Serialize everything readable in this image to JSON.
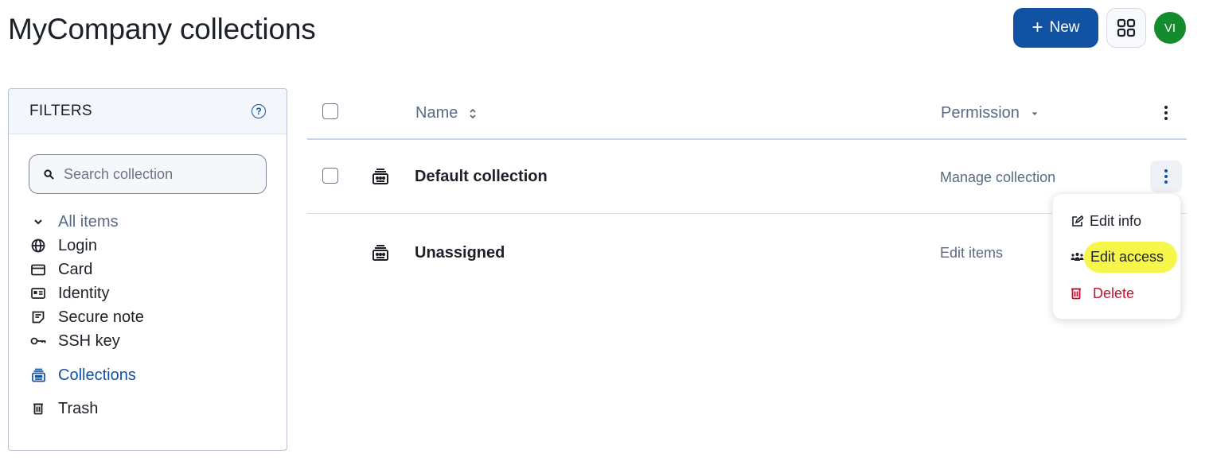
{
  "page": {
    "title": "MyCompany collections"
  },
  "header": {
    "new_label": "New",
    "apps_icon": "apps-grid-icon",
    "avatar_initials": "VI",
    "avatar_color": "#148b2d",
    "accent_color": "#1252a3"
  },
  "filters": {
    "title": "FILTERS",
    "search_placeholder": "Search collection",
    "items": [
      {
        "label": "All items",
        "icon": "chevron-down-icon"
      },
      {
        "label": "Login",
        "icon": "globe-icon"
      },
      {
        "label": "Card",
        "icon": "card-icon"
      },
      {
        "label": "Identity",
        "icon": "id-card-icon"
      },
      {
        "label": "Secure note",
        "icon": "note-icon"
      },
      {
        "label": "SSH key",
        "icon": "key-icon"
      },
      {
        "label": "Collections",
        "icon": "collection-icon"
      },
      {
        "label": "Trash",
        "icon": "trash-icon"
      }
    ]
  },
  "table": {
    "columns": {
      "name": "Name",
      "permission": "Permission"
    },
    "rows": [
      {
        "name": "Default collection",
        "permission": "Manage collection"
      },
      {
        "name": "Unassigned",
        "permission": "Edit items"
      }
    ]
  },
  "menu": {
    "items": [
      {
        "label": "Edit info",
        "icon": "edit-icon"
      },
      {
        "label": "Edit access",
        "icon": "users-icon"
      },
      {
        "label": "Delete",
        "icon": "trash-icon"
      }
    ]
  }
}
